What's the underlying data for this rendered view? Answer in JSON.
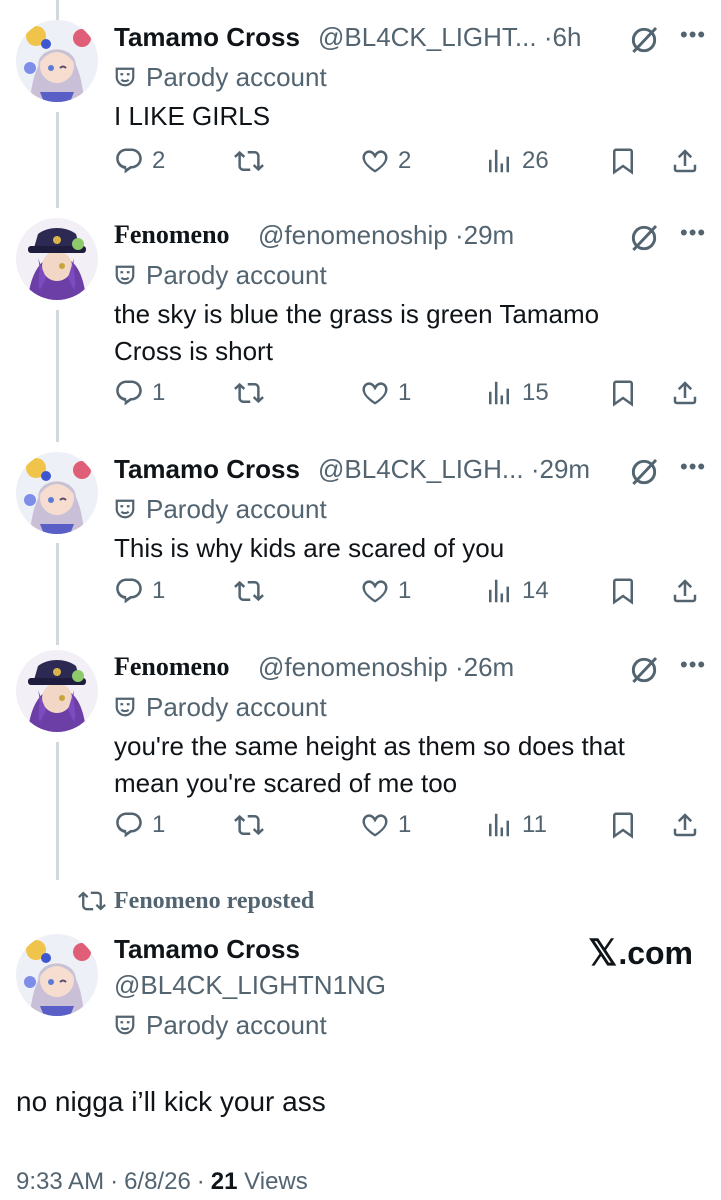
{
  "tweets": [
    {
      "name": "Tamamo Cross",
      "handle": "@BL4CK_LIGHT...",
      "time": "6h",
      "badge": "Parody account",
      "text": "I LIKE GIRLS",
      "replies": "2",
      "reposts": "",
      "likes": "2",
      "views": "26"
    },
    {
      "name": "Fenomeno",
      "handle": "@fenomenoship",
      "time": "29m",
      "badge": "Parody account",
      "text_lines": [
        "the sky is blue the grass is green Tamamo",
        "Cross is short"
      ],
      "replies": "1",
      "reposts": "",
      "likes": "1",
      "views": "15"
    },
    {
      "name": "Tamamo Cross",
      "handle": "@BL4CK_LIGH...",
      "time": "29m",
      "badge": "Parody account",
      "text": "This is why kids are scared of you",
      "replies": "1",
      "reposts": "",
      "likes": "1",
      "views": "14"
    },
    {
      "name": "Fenomeno",
      "handle": "@fenomenoship",
      "time": "26m",
      "badge": "Parody account",
      "text_lines": [
        "you're the same height as them so does that",
        "mean you're scared of me too"
      ],
      "replies": "1",
      "reposts": "",
      "likes": "1",
      "views": "11"
    }
  ],
  "repost_label": "Fenomeno reposted",
  "main_tweet": {
    "name": "Tamamo Cross",
    "handle": "@BL4CK_LIGHTN1NG",
    "badge": "Parody account",
    "text": "no nigga i’ll kick your ass",
    "time": "9:33 AM",
    "date": "6/8/26",
    "views_count": "21",
    "views_label": "Views"
  },
  "watermark": {
    "x": "𝕏",
    "text": ".com"
  },
  "separator": "·",
  "icons": [
    "reply-icon",
    "repost-icon",
    "like-icon",
    "views-icon",
    "bookmark-icon",
    "share-icon",
    "grok-icon",
    "more-icon",
    "parody-mask-icon"
  ],
  "colors": {
    "text": "#0f1419",
    "secondary": "#536471",
    "thread_line": "#cfd9de"
  }
}
